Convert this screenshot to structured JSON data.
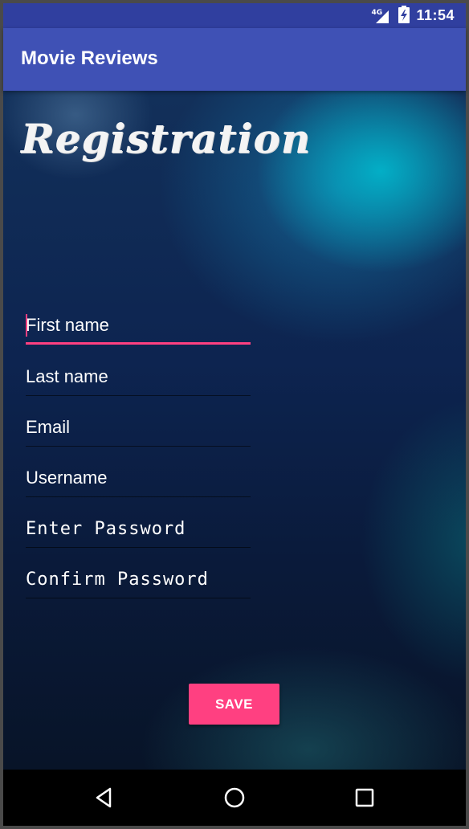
{
  "status_bar": {
    "network": "4G",
    "time": "11:54",
    "icons": [
      "signal-icon",
      "battery-charging-icon"
    ]
  },
  "app_bar": {
    "title": "Movie Reviews"
  },
  "form": {
    "heading": "Registration",
    "fields": {
      "first_name": {
        "placeholder": "First name",
        "value": ""
      },
      "last_name": {
        "placeholder": "Last name",
        "value": ""
      },
      "email": {
        "placeholder": "Email",
        "value": ""
      },
      "username": {
        "placeholder": "Username",
        "value": ""
      },
      "password": {
        "placeholder": "Enter Password",
        "value": ""
      },
      "confirm_password": {
        "placeholder": "Confirm Password",
        "value": ""
      }
    },
    "save_label": "SAVE"
  },
  "nav": {
    "icons": [
      "back-icon",
      "home-icon",
      "recents-icon"
    ]
  },
  "colors": {
    "status_bar": "#303f9f",
    "app_bar": "#3f51b5",
    "accent": "#ff4081"
  }
}
